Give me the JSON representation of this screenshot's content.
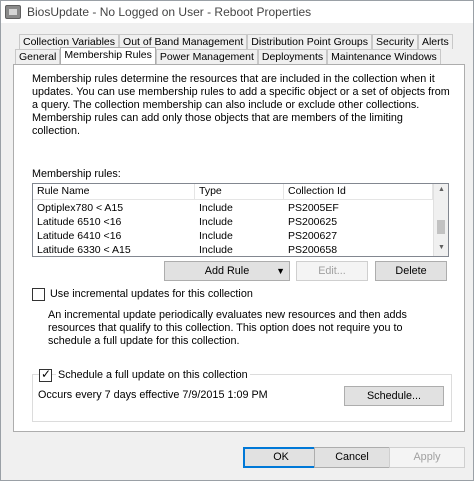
{
  "window": {
    "title": "BiosUpdate - No Logged on User - Reboot Properties"
  },
  "tabs": {
    "row1": [
      "Collection Variables",
      "Out of Band Management",
      "Distribution Point Groups",
      "Security",
      "Alerts"
    ],
    "row2": [
      "General",
      "Membership Rules",
      "Power Management",
      "Deployments",
      "Maintenance Windows"
    ],
    "active": "Membership Rules"
  },
  "membership": {
    "description": "Membership rules determine the resources that are included in the collection when it updates. You can use membership rules to add a specific object or a set of objects from a query. The collection membership can also include or exclude other collections. Membership rules can add only those objects that are members of the limiting collection.",
    "rules_label": "Membership rules:",
    "columns": [
      "Rule Name",
      "Type",
      "Collection Id"
    ],
    "rows": [
      [
        "Optiplex780 < A15",
        "Include",
        "PS2005EF"
      ],
      [
        "Latitude 6510 <16",
        "Include",
        "PS200625"
      ],
      [
        "Latitude 6410 <16",
        "Include",
        "PS200627"
      ],
      [
        "Latitude 6330 < A15",
        "Include",
        "PS200658"
      ]
    ],
    "add_rule_label": "Add Rule",
    "edit_label": "Edit...",
    "delete_label": "Delete"
  },
  "incremental": {
    "label": "Use incremental updates for this collection",
    "checked": false,
    "description": "An incremental update periodically evaluates new resources and then adds resources that qualify to this collection. This option does not require you to schedule a full update for this collection."
  },
  "schedule": {
    "label": "Schedule a full update on this collection",
    "checked": true,
    "summary": "Occurs every 7 days effective 7/9/2015 1:09 PM",
    "button_label": "Schedule..."
  },
  "footer": {
    "ok_label": "OK",
    "cancel_label": "Cancel",
    "apply_label": "Apply"
  },
  "icons": {
    "app": "window-icon",
    "check": "checkmark-icon",
    "dropdown": "triangle-down-icon"
  }
}
